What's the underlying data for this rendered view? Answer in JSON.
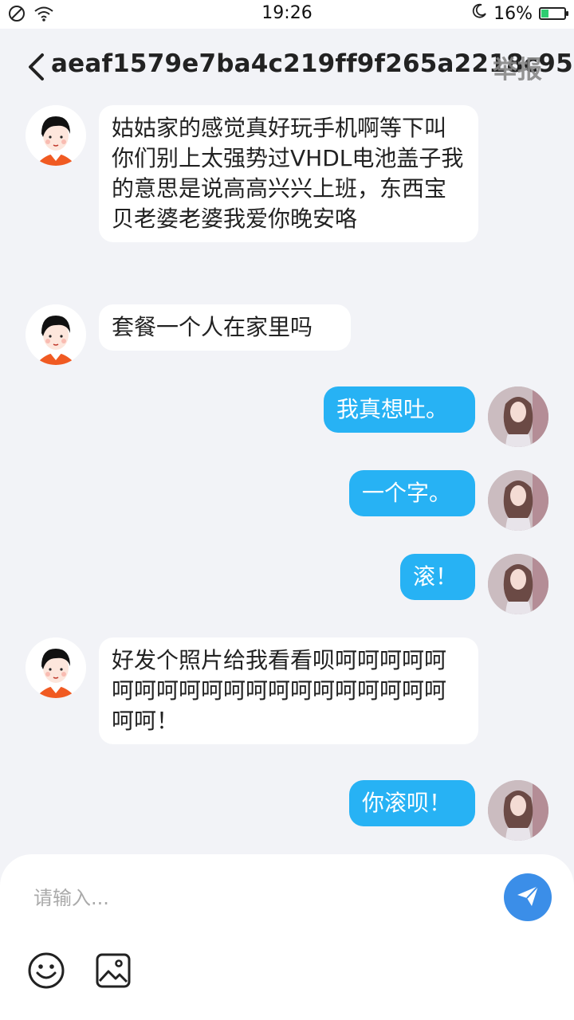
{
  "status_bar": {
    "time": "19:26",
    "battery_percent": "16%",
    "battery_level": 0.16
  },
  "header": {
    "title": "aeaf1579e7ba4c219ff9f265a2218c95",
    "report_label": "举报"
  },
  "messages": [
    {
      "side": "left",
      "text": "姑姑家的感觉真好玩手机啊等下叫你们别上太强势过VHDL电池盖子我的意思是说高高兴兴上班，东西宝贝老婆老婆我爱你晚安咯"
    },
    {
      "side": "left",
      "text": "套餐一个人在家里吗"
    },
    {
      "side": "right",
      "text": "我真想吐。"
    },
    {
      "side": "right",
      "text": "一个字。"
    },
    {
      "side": "right",
      "text": "滚！"
    },
    {
      "side": "left",
      "text": "好发个照片给我看看呗呵呵呵呵呵呵呵呵呵呵呵呵呵呵呵呵呵呵呵呵呵呵！"
    },
    {
      "side": "right",
      "text": "你滚呗！"
    }
  ],
  "input": {
    "placeholder": "请输入..."
  },
  "icons": {
    "back": "chevron-left-icon",
    "send": "send-icon",
    "emoji": "emoji-icon",
    "image": "image-icon"
  },
  "colors": {
    "background": "#f2f3f7",
    "outgoing_bubble": "#27b2f4",
    "incoming_bubble": "#ffffff",
    "send_button": "#3b8ee8"
  }
}
